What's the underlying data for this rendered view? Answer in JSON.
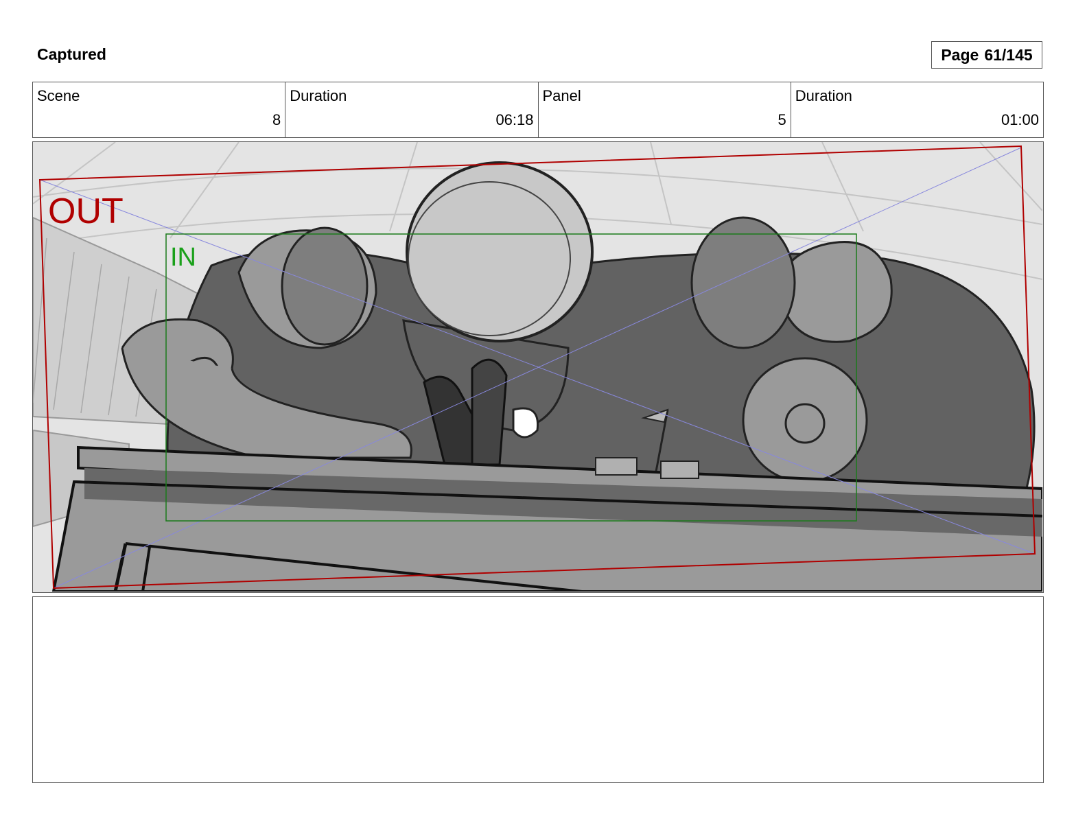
{
  "header": {
    "title": "Captured",
    "page_label": "Page",
    "page_number": "61/145"
  },
  "info": {
    "scene_label": "Scene",
    "scene_value": "8",
    "scene_duration_label": "Duration",
    "scene_duration_value": "06:18",
    "panel_label": "Panel",
    "panel_value": "5",
    "panel_duration_label": "Duration",
    "panel_duration_value": "01:00"
  },
  "panel": {
    "out_label": "OUT",
    "in_label": "IN",
    "colors": {
      "out_frame": "#b00000",
      "in_frame": "#1a7a1a",
      "diagonal_guides": "#8888dd",
      "sky": "#e4e4e4",
      "figure_dark": "#626262",
      "figure_mid": "#9a9a9a",
      "figure_light": "#c8c8c8"
    }
  },
  "notes": {
    "text": ""
  }
}
